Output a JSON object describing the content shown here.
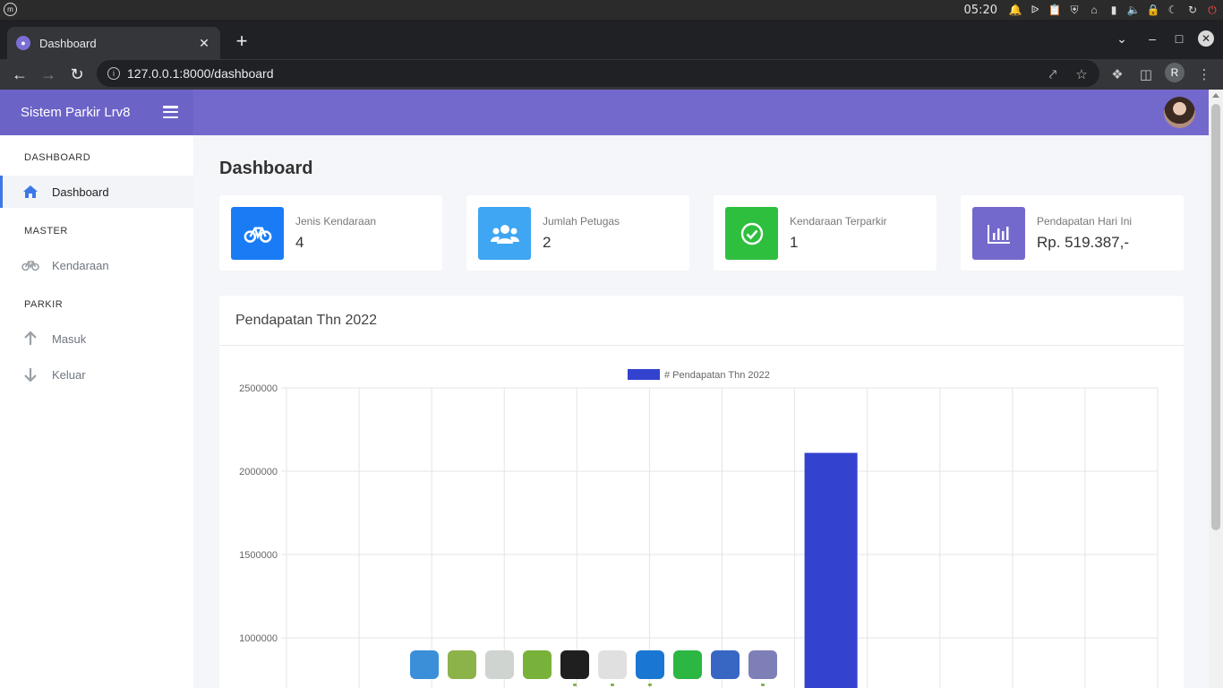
{
  "os": {
    "time": "05:20",
    "tray_icons": [
      "notification-icon",
      "bluetooth-icon",
      "clipboard-icon",
      "shield-icon",
      "wifi-icon",
      "battery-icon",
      "volume-icon",
      "lock-icon",
      "night-mode-icon",
      "update-icon",
      "power-icon"
    ]
  },
  "browser": {
    "tab_title": "Dashboard",
    "url": "127.0.0.1:8000/dashboard",
    "profile_initial": "R"
  },
  "app": {
    "brand": "Sistem Parkir Lrv8",
    "page_title": "Dashboard"
  },
  "sidebar": {
    "sections": [
      {
        "heading": "DASHBOARD",
        "items": [
          {
            "label": "Dashboard",
            "icon": "home-icon",
            "active": true
          }
        ]
      },
      {
        "heading": "MASTER",
        "items": [
          {
            "label": "Kendaraan",
            "icon": "bicycle-icon",
            "active": false
          }
        ]
      },
      {
        "heading": "PARKIR",
        "items": [
          {
            "label": "Masuk",
            "icon": "arrow-up-icon",
            "active": false
          },
          {
            "label": "Keluar",
            "icon": "arrow-down-icon",
            "active": false
          }
        ]
      }
    ]
  },
  "stats": [
    {
      "label": "Jenis Kendaraan",
      "value": "4",
      "icon": "bicycle-icon",
      "color": "#1a7cf5"
    },
    {
      "label": "Jumlah Petugas",
      "value": "2",
      "icon": "users-icon",
      "color": "#3ea6f2"
    },
    {
      "label": "Kendaraan Terparkir",
      "value": "1",
      "icon": "check-circle-icon",
      "color": "#2fbf3f"
    },
    {
      "label": "Pendapatan Hari Ini",
      "value": "Rp. 519.387,-",
      "icon": "bar-chart-icon",
      "color": "#7369cc"
    }
  ],
  "chart_card": {
    "title": "Pendapatan Thn 2022"
  },
  "chart_data": {
    "type": "bar",
    "legend": "# Pendapatan Thn 2022",
    "legend_position": "top",
    "bar_color": "#3342cf",
    "categories": [
      "",
      "",
      "",
      "",
      "",
      "",
      "",
      "",
      "",
      "",
      "",
      ""
    ],
    "series": [
      {
        "name": "# Pendapatan Thn 2022",
        "values": [
          0,
          0,
          0,
          0,
          0,
          0,
          0,
          2110000,
          0,
          0,
          0,
          0
        ]
      }
    ],
    "y_ticks": [
      2500000,
      2000000,
      1500000,
      1000000
    ],
    "ylim_visible": [
      1000000,
      2500000
    ],
    "grid": true
  },
  "dock": {
    "items": [
      {
        "name": "desktop-app",
        "color": "#3a8fd8",
        "running": false
      },
      {
        "name": "files-app",
        "color": "#8cb34a",
        "running": false
      },
      {
        "name": "settings-app",
        "color": "#cfd4d1",
        "running": false
      },
      {
        "name": "spreadsheet-app",
        "color": "#79b23a",
        "running": false
      },
      {
        "name": "terminal-app",
        "color": "#1f1f1f",
        "running": true
      },
      {
        "name": "chrome-app",
        "color": "#e0e0e0",
        "running": true
      },
      {
        "name": "vscode-app",
        "color": "#1976d2",
        "running": true
      },
      {
        "name": "whatsapp-app",
        "color": "#2bb742",
        "running": false
      },
      {
        "name": "tasks-app",
        "color": "#3867c3",
        "running": false
      },
      {
        "name": "text-editor-app",
        "color": "#7f7fb8",
        "running": true
      }
    ]
  }
}
